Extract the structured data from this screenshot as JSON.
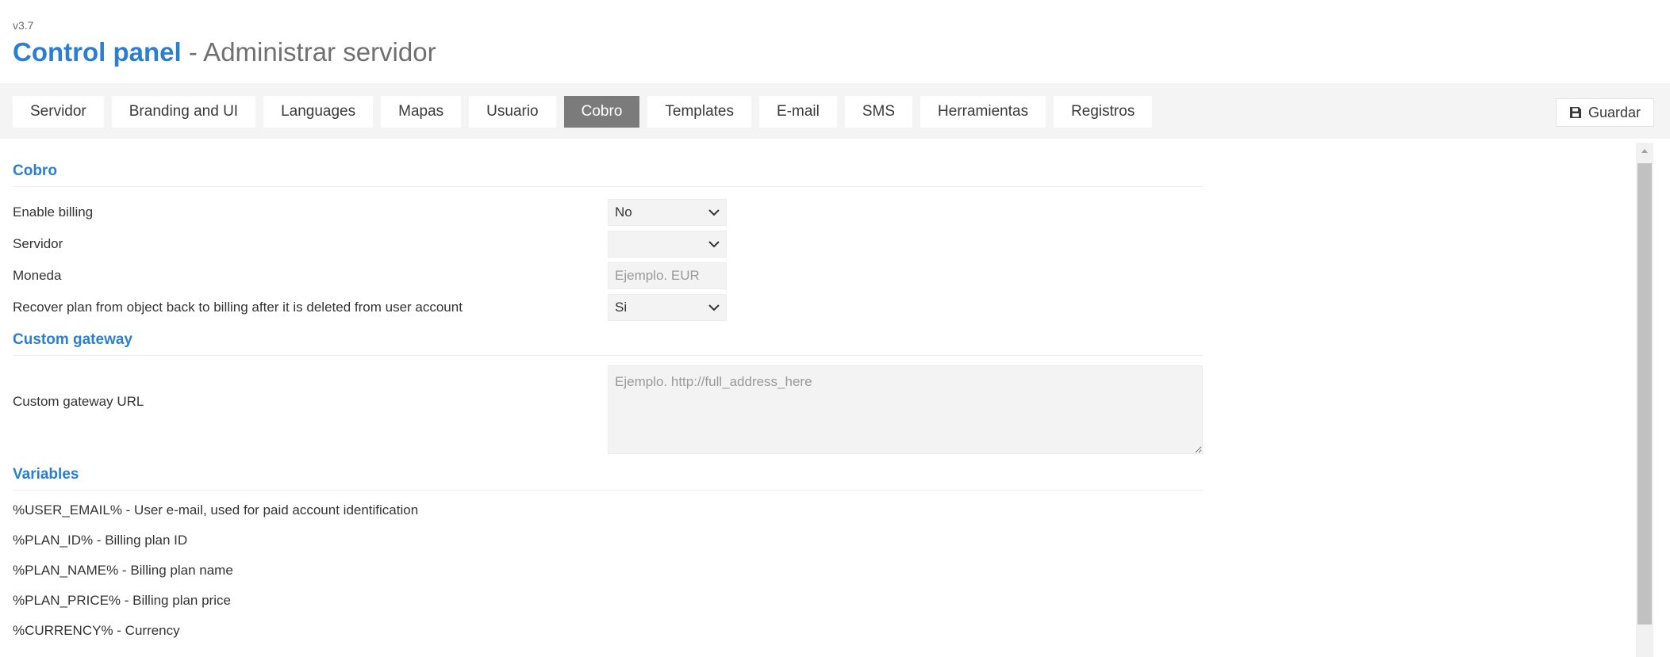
{
  "header": {
    "version": "v3.7",
    "title": "Control panel",
    "subtitle": " - Administrar servidor"
  },
  "tabs": [
    {
      "label": "Servidor"
    },
    {
      "label": "Branding and UI"
    },
    {
      "label": "Languages"
    },
    {
      "label": "Mapas"
    },
    {
      "label": "Usuario"
    },
    {
      "label": "Cobro",
      "active": true
    },
    {
      "label": "Templates"
    },
    {
      "label": "E-mail"
    },
    {
      "label": "SMS"
    },
    {
      "label": "Herramientas"
    },
    {
      "label": "Registros"
    }
  ],
  "toolbar": {
    "save_label": "Guardar",
    "save_icon": "floppy-disk-icon"
  },
  "billing": {
    "section_title": "Cobro",
    "enable_billing_label": "Enable billing",
    "enable_billing_value": "No",
    "server_label": "Servidor",
    "server_value": "",
    "currency_label": "Moneda",
    "currency_value": "",
    "currency_placeholder": "Ejemplo. EUR",
    "recover_plan_label": "Recover plan from object back to billing after it is deleted from user account",
    "recover_plan_value": "Si"
  },
  "custom_gateway": {
    "section_title": "Custom gateway",
    "url_label": "Custom gateway URL",
    "url_value": "",
    "url_placeholder": "Ejemplo. http://full_address_here"
  },
  "variables": {
    "section_title": "Variables",
    "items": [
      "%USER_EMAIL% - User e-mail, used for paid account identification",
      "%PLAN_ID% - Billing plan ID",
      "%PLAN_NAME% - Billing plan name",
      "%PLAN_PRICE% - Billing plan price",
      "%CURRENCY% - Currency"
    ]
  },
  "colors": {
    "accent": "#2a7fd4",
    "active_tab": "#7b7b7b",
    "toolbar_bg": "#f4f4f4"
  }
}
